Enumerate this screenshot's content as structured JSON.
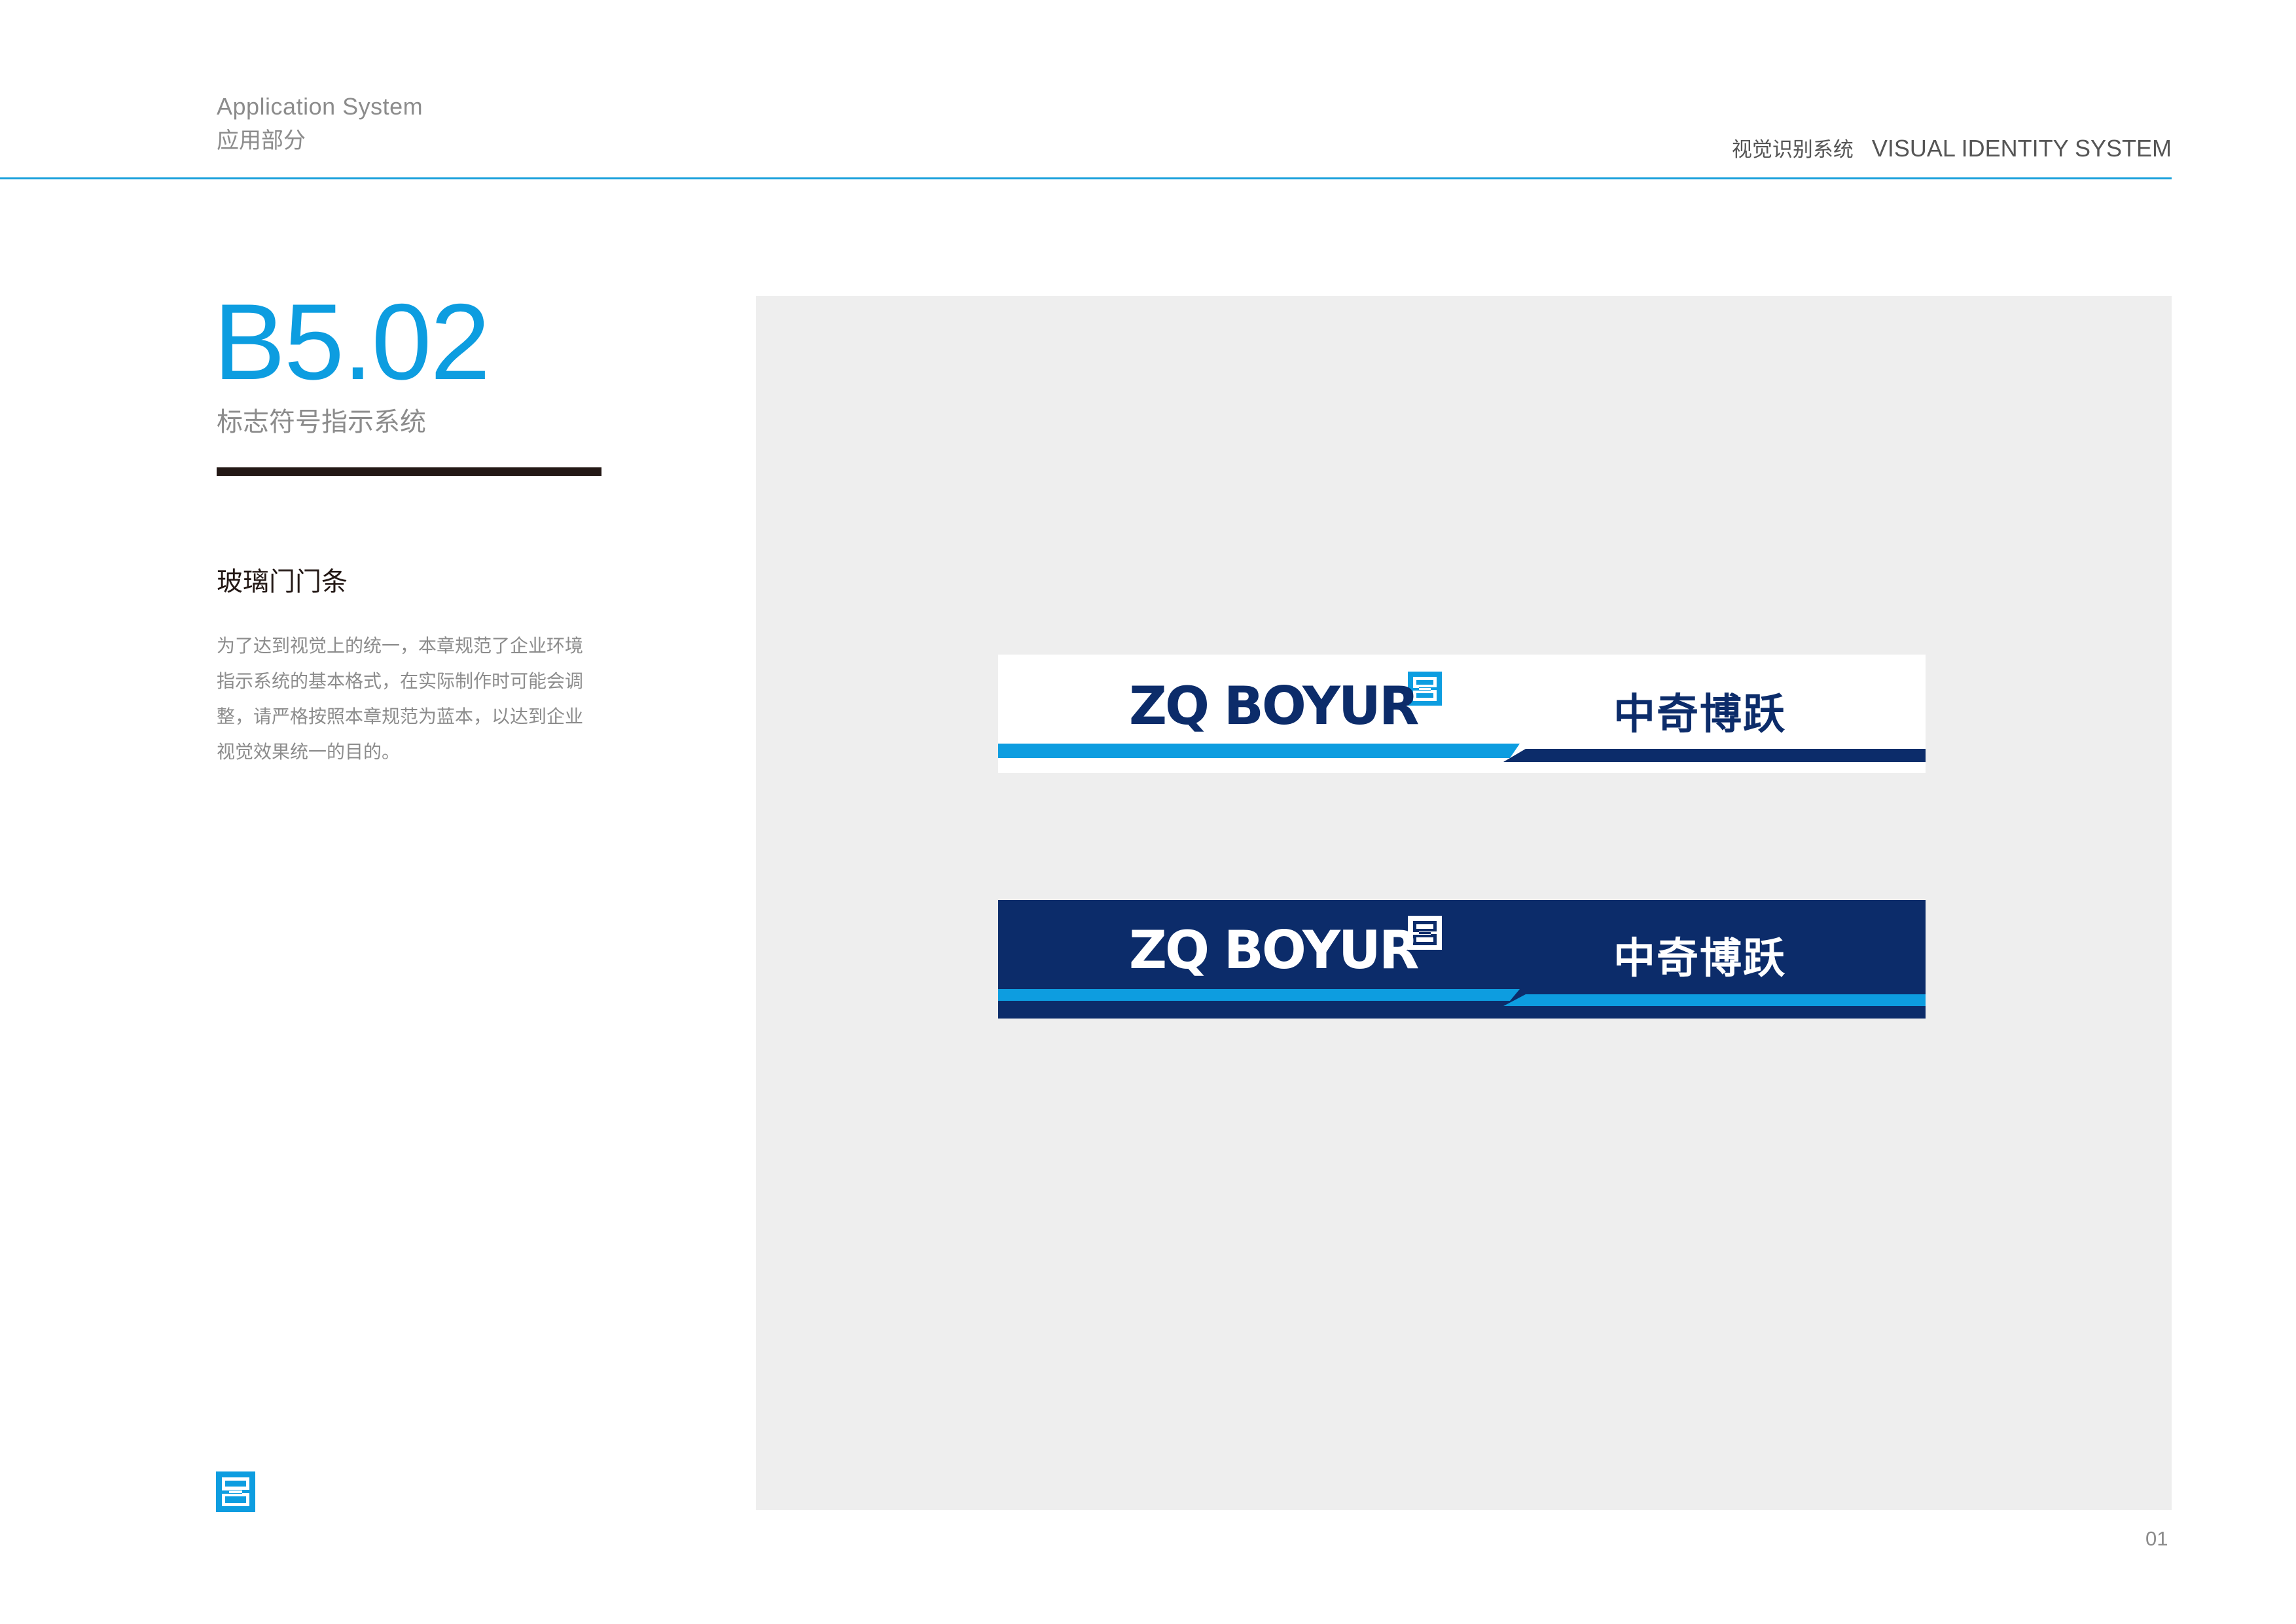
{
  "header": {
    "section_en": "Application System",
    "section_cn": "应用部分",
    "system_cn": "视觉识别系统",
    "system_en": "VISUAL IDENTITY SYSTEM",
    "accent_color": "#1aa0dc"
  },
  "chapter": {
    "code": "B5.02",
    "title": "标志符号指示系统",
    "code_color": "#0d9de0"
  },
  "item": {
    "title": "玻璃门门条",
    "description_lines": [
      "为了达到视觉上的统一，本章规范了企业环境",
      "指示系统的基本格式，在实际制作时可能会调",
      "整，请严格按照本章规范为蓝本，以达到企业",
      "视觉效果统一的目的。"
    ]
  },
  "strips": [
    {
      "variant": "light",
      "background": "#ffffff",
      "logo_en": "ZQ BOYUR",
      "logo_cn": "中奇博跃",
      "text_color": "#0c2c6a",
      "band_left_color": "#0d9de0",
      "band_right_color": "#0c2c6a"
    },
    {
      "variant": "dark",
      "background": "#0c2c6a",
      "logo_en": "ZQ BOYUR",
      "logo_cn": "中奇博跃",
      "text_color": "#ffffff",
      "band_left_color": "#0d9de0",
      "band_right_color": "#0d9de0"
    }
  ],
  "footer": {
    "page_number": "01",
    "logo_icon": "zq-mark-icon"
  }
}
